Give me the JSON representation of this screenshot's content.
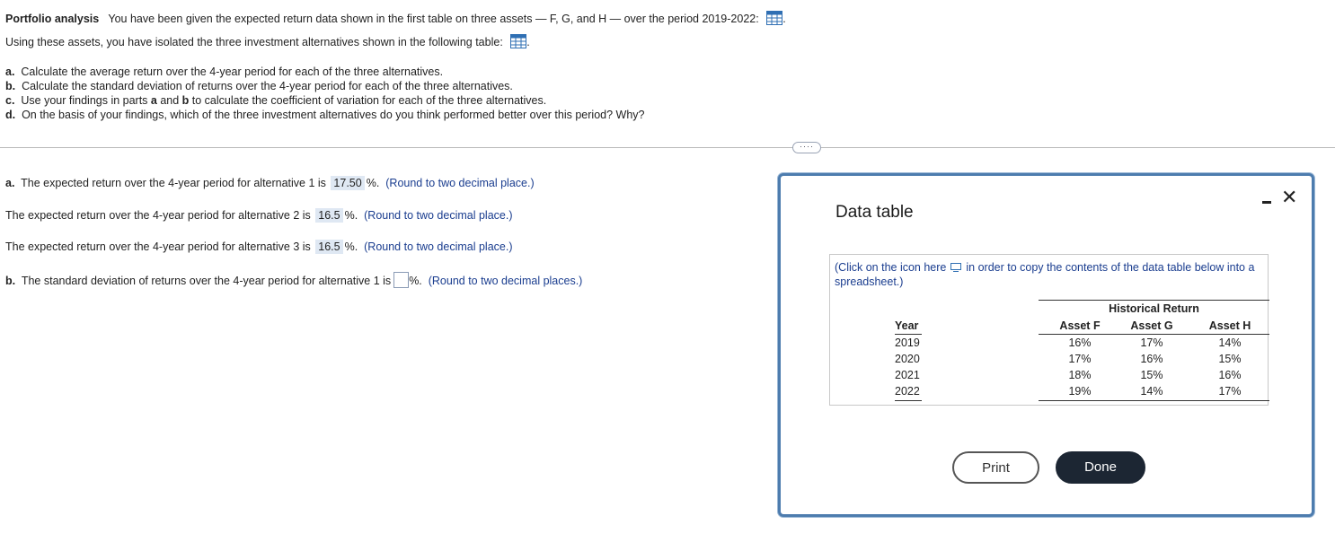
{
  "problem": {
    "title": "Portfolio analysis",
    "intro1": "You have been given the expected return data shown in the first table on three assets — F, G, and H — over the period 2019-2022:",
    "intro2": "Using these assets, you have isolated the three investment alternatives shown in the following table:",
    "period_after": ".",
    "parts": [
      {
        "letter": "a.",
        "text": "Calculate the average return over the 4-year period for each of the three alternatives."
      },
      {
        "letter": "b.",
        "text": "Calculate the standard deviation of returns over the 4-year period for each of the three alternatives."
      },
      {
        "letter": "c.",
        "text_pre": "Use your findings in parts ",
        "a": "a",
        "and": " and ",
        "b": "b",
        "text_post": " to calculate the coefficient of variation for each of the three alternatives."
      },
      {
        "letter": "d.",
        "text": "On the basis of your findings, which of the three investment alternatives do you think performed better over this period? Why?"
      }
    ]
  },
  "answers": [
    {
      "pre": "The expected return over the 4-year period for alternative 1 is",
      "value": "17.50",
      "post": "%.",
      "hint": "(Round to two decimal place.)",
      "letter": "a."
    },
    {
      "pre": "The expected return over the 4-year period for alternative 2 is",
      "value": "16.5",
      "post": "%.",
      "hint": "(Round to two decimal place.)"
    },
    {
      "pre": "The expected return over the 4-year period for alternative 3 is",
      "value": "16.5",
      "post": "%.",
      "hint": "(Round to two decimal place.)"
    },
    {
      "letter": "b.",
      "pre": "The standard deviation of returns over the 4-year period for alternative 1 is",
      "value": "",
      "post": "%.",
      "hint": "(Round to two decimal places.)"
    }
  ],
  "expand_button": "····",
  "modal": {
    "title": "Data table",
    "note_pre": "(Click on the icon here",
    "note_post": "in order to copy the contents of the data table below into a spreadsheet.)",
    "group_header": "Historical Return",
    "col_year": "Year",
    "cols": [
      "Asset F",
      "Asset G",
      "Asset H"
    ],
    "rows": [
      {
        "year": "2019",
        "f": "16%",
        "g": "17%",
        "h": "14%"
      },
      {
        "year": "2020",
        "f": "17%",
        "g": "16%",
        "h": "15%"
      },
      {
        "year": "2021",
        "f": "18%",
        "g": "15%",
        "h": "16%"
      },
      {
        "year": "2022",
        "f": "19%",
        "g": "14%",
        "h": "17%"
      }
    ],
    "print_label": "Print",
    "done_label": "Done",
    "close_symbol": "✕"
  },
  "colors": {
    "accent": "#4d7cae",
    "link_blue": "#1a3d8f",
    "answer_bg": "#dfe8f3",
    "done_bg": "#1c2633"
  }
}
